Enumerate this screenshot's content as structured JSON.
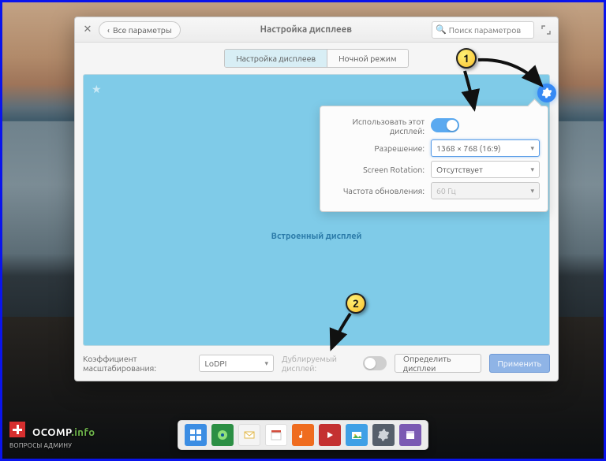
{
  "window": {
    "close_tooltip": "Закрыть",
    "back_label": "Все параметры",
    "title": "Настройка дисплеев",
    "search_placeholder": "Поиск параметров"
  },
  "tabs": [
    {
      "label": "Настройка дисплеев",
      "active": true
    },
    {
      "label": "Ночной режим",
      "active": false
    }
  ],
  "display": {
    "name": "Встроенный дисплей"
  },
  "popover": {
    "use_display_label": "Использовать этот дисплей:",
    "use_display_on": true,
    "resolution_label": "Разрешение:",
    "resolution_value": "1368 × 768 (16:9)",
    "rotation_label": "Screen Rotation:",
    "rotation_value": "Отсутствует",
    "refresh_label": "Частота обновления:",
    "refresh_value": "60 Гц"
  },
  "bottom": {
    "scale_label": "Коэффициент масштабирования:",
    "scale_value": "LoDPI",
    "mirror_label": "Дублируемый дисплей:",
    "mirror_on": false,
    "detect_label": "Определить дисплеи",
    "apply_label": "Применить"
  },
  "callouts": {
    "c1": "1",
    "c2": "2"
  },
  "dock_icons": [
    "apps-icon",
    "browser-icon",
    "mail-icon",
    "calendar-icon",
    "music-icon",
    "videos-icon",
    "photos-icon",
    "settings-icon",
    "software-icon"
  ],
  "watermark": {
    "line1_a": "OCOMP",
    "line1_b": ".info",
    "line2": "ВОПРОСЫ АДМИНУ"
  }
}
